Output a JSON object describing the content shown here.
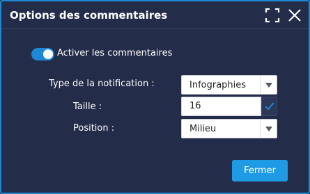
{
  "dialog": {
    "title": "Options des commentaires",
    "maximize_icon": "maximize-icon",
    "close_icon": "close-icon",
    "accent_color": "#1e88d6"
  },
  "comments_toggle": {
    "label": "Activer les commentaires",
    "enabled": true
  },
  "fields": {
    "type": {
      "label": "Type de la notification :",
      "value": "Infographies"
    },
    "size": {
      "label": "Taille :",
      "value": "16"
    },
    "position": {
      "label": "Position :",
      "value": "Milieu"
    }
  },
  "footer": {
    "close_label": "Fermer"
  }
}
